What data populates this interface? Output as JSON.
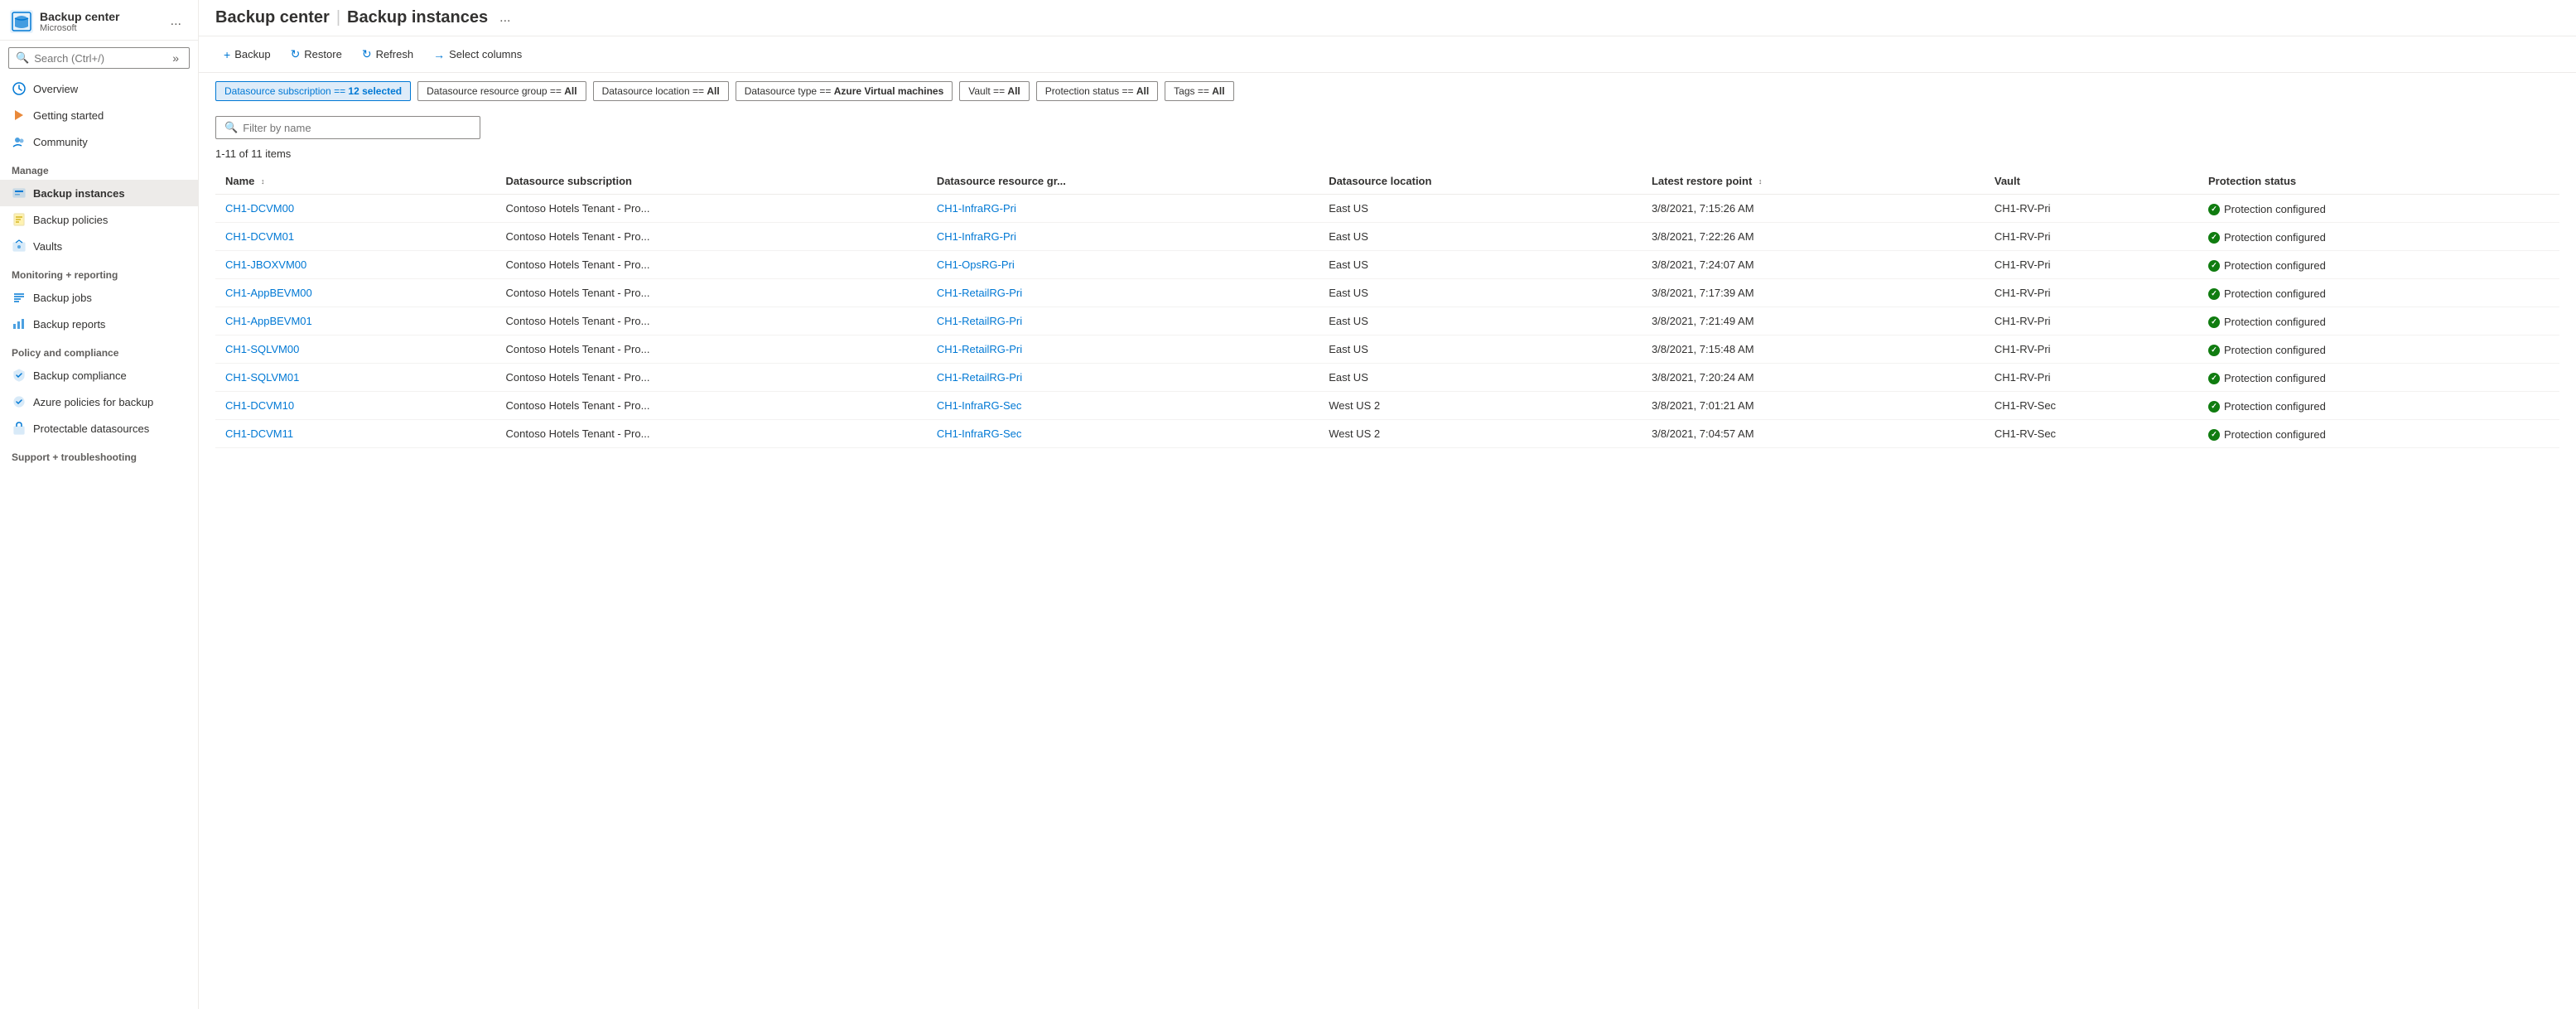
{
  "app": {
    "title": "Backup center",
    "separator": "|",
    "subtitle": "Backup instances",
    "provider": "Microsoft",
    "more_label": "..."
  },
  "search": {
    "placeholder": "Search (Ctrl+/)"
  },
  "sidebar": {
    "nav_items": [
      {
        "id": "overview",
        "label": "Overview",
        "icon": "cloud-icon",
        "section": ""
      },
      {
        "id": "getting-started",
        "label": "Getting started",
        "icon": "lightning-icon",
        "section": ""
      },
      {
        "id": "community",
        "label": "Community",
        "icon": "people-icon",
        "section": ""
      }
    ],
    "sections": [
      {
        "label": "Manage",
        "items": [
          {
            "id": "backup-instances",
            "label": "Backup instances",
            "icon": "instances-icon",
            "active": true
          },
          {
            "id": "backup-policies",
            "label": "Backup policies",
            "icon": "policies-icon",
            "active": false
          },
          {
            "id": "vaults",
            "label": "Vaults",
            "icon": "vaults-icon",
            "active": false
          }
        ]
      },
      {
        "label": "Monitoring + reporting",
        "items": [
          {
            "id": "backup-jobs",
            "label": "Backup jobs",
            "icon": "jobs-icon",
            "active": false
          },
          {
            "id": "backup-reports",
            "label": "Backup reports",
            "icon": "reports-icon",
            "active": false
          }
        ]
      },
      {
        "label": "Policy and compliance",
        "items": [
          {
            "id": "backup-compliance",
            "label": "Backup compliance",
            "icon": "compliance-icon",
            "active": false
          },
          {
            "id": "azure-policies",
            "label": "Azure policies for backup",
            "icon": "azure-policy-icon",
            "active": false
          },
          {
            "id": "protectable",
            "label": "Protectable datasources",
            "icon": "protectable-icon",
            "active": false
          }
        ]
      },
      {
        "label": "Support + troubleshooting",
        "items": []
      }
    ]
  },
  "toolbar": {
    "backup_label": "Backup",
    "restore_label": "Restore",
    "refresh_label": "Refresh",
    "select_columns_label": "Select columns"
  },
  "filters": [
    {
      "id": "datasource-subscription",
      "text": "Datasource subscription == ",
      "bold": "12 selected",
      "active": true
    },
    {
      "id": "datasource-rg",
      "text": "Datasource resource group == ",
      "bold": "All",
      "active": false
    },
    {
      "id": "datasource-location",
      "text": "Datasource location == ",
      "bold": "All",
      "active": false
    },
    {
      "id": "datasource-type",
      "text": "Datasource type == ",
      "bold": "Azure Virtual machines",
      "active": false
    },
    {
      "id": "vault",
      "text": "Vault == ",
      "bold": "All",
      "active": false
    },
    {
      "id": "protection-status",
      "text": "Protection status == ",
      "bold": "All",
      "active": false
    },
    {
      "id": "tags",
      "text": "Tags == ",
      "bold": "All",
      "active": false
    }
  ],
  "filter_input": {
    "placeholder": "Filter by name"
  },
  "item_count": "1-11 of 11 items",
  "table": {
    "columns": [
      {
        "id": "name",
        "label": "Name",
        "sortable": true
      },
      {
        "id": "datasource-sub",
        "label": "Datasource subscription",
        "sortable": false
      },
      {
        "id": "datasource-rg",
        "label": "Datasource resource gr...",
        "sortable": false
      },
      {
        "id": "datasource-location",
        "label": "Datasource location",
        "sortable": false
      },
      {
        "id": "latest-restore",
        "label": "Latest restore point",
        "sortable": true
      },
      {
        "id": "vault",
        "label": "Vault",
        "sortable": false
      },
      {
        "id": "protection-status",
        "label": "Protection status",
        "sortable": false
      }
    ],
    "rows": [
      {
        "name": "CH1-DCVM00",
        "datasource_sub": "Contoso Hotels Tenant - Pro...",
        "datasource_rg": "CH1-InfraRG-Pri",
        "datasource_location": "East US",
        "latest_restore": "3/8/2021, 7:15:26 AM",
        "vault": "CH1-RV-Pri",
        "protection_status": "Protection configured"
      },
      {
        "name": "CH1-DCVM01",
        "datasource_sub": "Contoso Hotels Tenant - Pro...",
        "datasource_rg": "CH1-InfraRG-Pri",
        "datasource_location": "East US",
        "latest_restore": "3/8/2021, 7:22:26 AM",
        "vault": "CH1-RV-Pri",
        "protection_status": "Protection configured"
      },
      {
        "name": "CH1-JBOXVM00",
        "datasource_sub": "Contoso Hotels Tenant - Pro...",
        "datasource_rg": "CH1-OpsRG-Pri",
        "datasource_location": "East US",
        "latest_restore": "3/8/2021, 7:24:07 AM",
        "vault": "CH1-RV-Pri",
        "protection_status": "Protection configured"
      },
      {
        "name": "CH1-AppBEVM00",
        "datasource_sub": "Contoso Hotels Tenant - Pro...",
        "datasource_rg": "CH1-RetailRG-Pri",
        "datasource_location": "East US",
        "latest_restore": "3/8/2021, 7:17:39 AM",
        "vault": "CH1-RV-Pri",
        "protection_status": "Protection configured"
      },
      {
        "name": "CH1-AppBEVM01",
        "datasource_sub": "Contoso Hotels Tenant - Pro...",
        "datasource_rg": "CH1-RetailRG-Pri",
        "datasource_location": "East US",
        "latest_restore": "3/8/2021, 7:21:49 AM",
        "vault": "CH1-RV-Pri",
        "protection_status": "Protection configured"
      },
      {
        "name": "CH1-SQLVM00",
        "datasource_sub": "Contoso Hotels Tenant - Pro...",
        "datasource_rg": "CH1-RetailRG-Pri",
        "datasource_location": "East US",
        "latest_restore": "3/8/2021, 7:15:48 AM",
        "vault": "CH1-RV-Pri",
        "protection_status": "Protection configured"
      },
      {
        "name": "CH1-SQLVM01",
        "datasource_sub": "Contoso Hotels Tenant - Pro...",
        "datasource_rg": "CH1-RetailRG-Pri",
        "datasource_location": "East US",
        "latest_restore": "3/8/2021, 7:20:24 AM",
        "vault": "CH1-RV-Pri",
        "protection_status": "Protection configured"
      },
      {
        "name": "CH1-DCVM10",
        "datasource_sub": "Contoso Hotels Tenant - Pro...",
        "datasource_rg": "CH1-InfraRG-Sec",
        "datasource_location": "West US 2",
        "latest_restore": "3/8/2021, 7:01:21 AM",
        "vault": "CH1-RV-Sec",
        "protection_status": "Protection configured"
      },
      {
        "name": "CH1-DCVM11",
        "datasource_sub": "Contoso Hotels Tenant - Pro...",
        "datasource_rg": "CH1-InfraRG-Sec",
        "datasource_location": "West US 2",
        "latest_restore": "3/8/2021, 7:04:57 AM",
        "vault": "CH1-RV-Sec",
        "protection_status": "Protection configured"
      }
    ]
  }
}
